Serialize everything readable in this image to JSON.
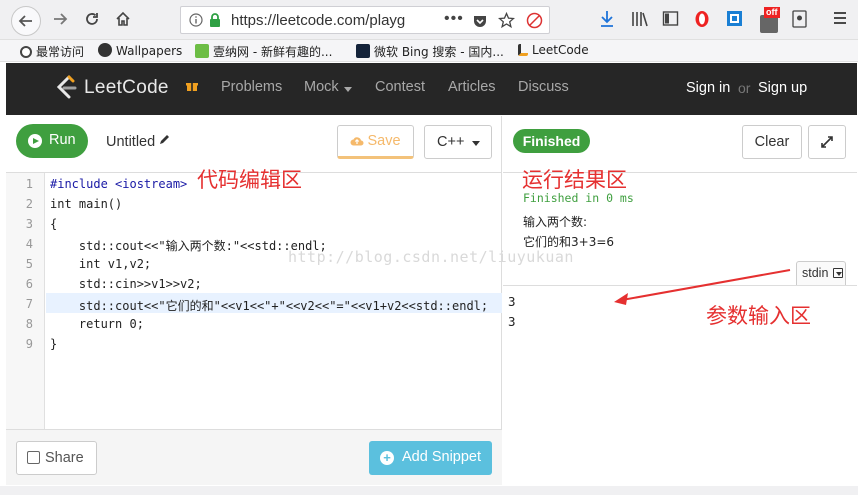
{
  "browser": {
    "url": "https://leetcode.com/playg",
    "bookmarks": [
      "最常访问",
      "Wallpapers",
      "壹纳网 - 新鲜有趣的...",
      "微软 Bing 搜索 - 国内...",
      "LeetCode"
    ],
    "extension_badge": "off"
  },
  "nav": {
    "logo": "LeetCode",
    "links": [
      "Problems",
      "Mock",
      "Contest",
      "Articles",
      "Discuss"
    ],
    "sign_in": "Sign in",
    "or": "or",
    "sign_up": "Sign up"
  },
  "editor_toolbar": {
    "run_label": "Run",
    "title": "Untitled",
    "save_label": "Save",
    "language": "C++"
  },
  "code": {
    "line_numbers": [
      "1",
      "2",
      "3",
      "4",
      "5",
      "6",
      "7",
      "8",
      "9"
    ],
    "lines": [
      "#include <iostream>",
      "int main()",
      "{",
      "    std::cout<<\"输入两个数:\"<<std::endl;",
      "    int v1,v2;",
      "    std::cin>>v1>>v2;",
      "    std::cout<<\"它们的和\"<<v1<<\"+\"<<v2<<\"=\"<<v1+v2<<std::endl;",
      "    return 0;",
      "}"
    ]
  },
  "footer": {
    "share_label": "Share",
    "add_snippet_label": "Add Snippet"
  },
  "result_panel": {
    "status_badge": "Finished",
    "clear_label": "Clear",
    "status_text": "Finished in 0 ms",
    "output_lines": [
      "输入两个数:",
      "它们的和3+3=6"
    ],
    "stdin_label": "stdin",
    "stdin_lines": [
      "3",
      "3"
    ]
  },
  "annotations": {
    "editor_area": "代码编辑区",
    "result_area": "运行结果区",
    "input_area": "参数输入区",
    "watermark": "http://blog.csdn.net/liuyukuan"
  },
  "colors": {
    "run_green": "#3f9f3f",
    "snippet_blue": "#5bc0de",
    "annotation_red": "#e53030",
    "nav_dark": "#262626"
  }
}
